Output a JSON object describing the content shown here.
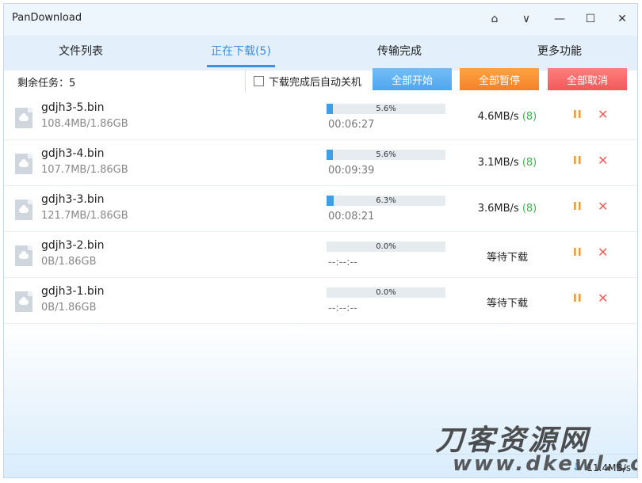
{
  "app": {
    "title": "PanDownload"
  },
  "window_controls": {
    "skin": "⌂",
    "menu": "∨",
    "minimize": "—",
    "maximize": "☐",
    "close": "✕"
  },
  "tabs": [
    {
      "label": "文件列表"
    },
    {
      "label": "正在下载(5)"
    },
    {
      "label": "传输完成"
    },
    {
      "label": "更多功能"
    }
  ],
  "toolbar": {
    "task_count": "剩余任务：5",
    "auto_shutdown_label": "下载完成后自动关机",
    "start_all": "全部开始",
    "pause_all": "全部暂停",
    "cancel_all": "全部取消"
  },
  "downloads": [
    {
      "name": "gdjh3-5.bin",
      "size": "108.4MB/1.86GB",
      "progress": 5.6,
      "progress_text": "5.6%",
      "time": "00:06:27",
      "speed": "4.6MB/s",
      "conns": "(8)"
    },
    {
      "name": "gdjh3-4.bin",
      "size": "107.7MB/1.86GB",
      "progress": 5.6,
      "progress_text": "5.6%",
      "time": "00:09:39",
      "speed": "3.1MB/s",
      "conns": "(8)"
    },
    {
      "name": "gdjh3-3.bin",
      "size": "121.7MB/1.86GB",
      "progress": 6.3,
      "progress_text": "6.3%",
      "time": "00:08:21",
      "speed": "3.6MB/s",
      "conns": "(8)"
    },
    {
      "name": "gdjh3-2.bin",
      "size": "0B/1.86GB",
      "progress": 0,
      "progress_text": "0.0%",
      "time": "--:--:--",
      "speed": "等待下载",
      "conns": ""
    },
    {
      "name": "gdjh3-1.bin",
      "size": "0B/1.86GB",
      "progress": 0,
      "progress_text": "0.0%",
      "time": "--:--:--",
      "speed": "等待下载",
      "conns": ""
    }
  ],
  "row_actions": {
    "pause": "II",
    "cancel": "✕"
  },
  "statusbar": {
    "total_speed": "11.4MB/s",
    "arrow": "↓"
  },
  "watermark": {
    "line1": "刀客资源网",
    "line2": "www.dkewl.com"
  },
  "colors": {
    "accent": "#3d8fe0",
    "start": "#4ea6ee",
    "pause": "#f4812b",
    "cancel": "#f05a5a",
    "conns": "#3bb44a"
  }
}
